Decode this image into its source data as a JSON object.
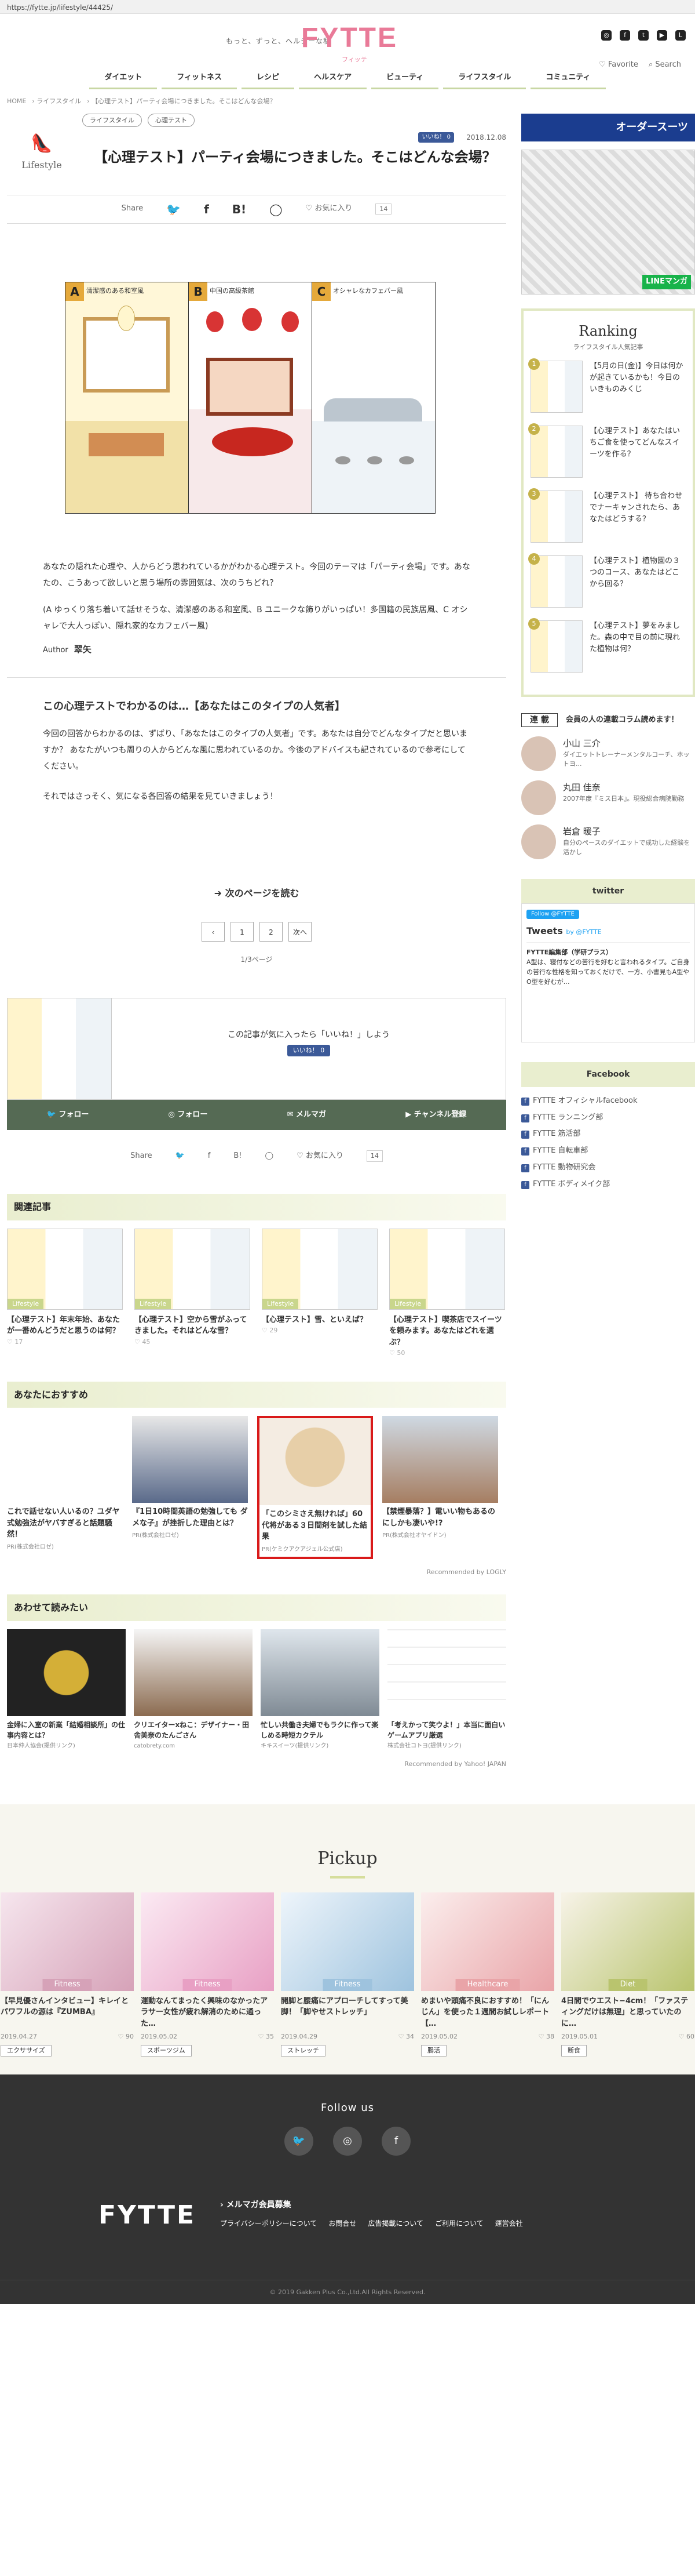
{
  "browser": {
    "url": "https://fytte.jp/lifestyle/44425/"
  },
  "header": {
    "tagline": "もっと、ずっと、ヘルシーな私",
    "logo": "FYTTE",
    "logo_sub": "フィッテ",
    "social": [
      "instagram-icon",
      "facebook-icon",
      "twitter-icon",
      "youtube-icon",
      "line-icon"
    ],
    "favorite": "Favorite",
    "search": "Search"
  },
  "nav": [
    "ダイエット",
    "フィットネス",
    "レシピ",
    "ヘルスケア",
    "ビューティ",
    "ライフスタイル",
    "コミュニティ"
  ],
  "breadcrumb": [
    "HOME",
    "ライフスタイル",
    "【心理テスト】パーティ会場につきました。そこはどんな会場？"
  ],
  "article": {
    "category": "Lifestyle",
    "tags": [
      "ライフスタイル",
      "心理テスト"
    ],
    "like_badge": "いいね！ 0",
    "date": "2018.12.08",
    "title": "【心理テスト】パーティ会場につきました。そこはどんな会場？",
    "share_label": "Share",
    "favorite_label": "お気に入り",
    "favorite_count": "14",
    "hero_panels": [
      {
        "letter": "A",
        "caption": "清潔感のある和室風"
      },
      {
        "letter": "B",
        "caption": "中国の高級茶館"
      },
      {
        "letter": "C",
        "caption": "オシャレなカフェバー風"
      }
    ],
    "intro1": "あなたの隠れた心理や、人からどう思われているかがわかる心理テスト。今回のテーマは「パーティ会場」です。あなたの、こうあって欲しいと思う場所の雰囲気は、次のうちどれ？",
    "intro2": "(A ゆっくり落ち着いて話せそうな、清潔感のある和室風、B ユニークな飾りがいっぱい！多国籍の民族居風、C オシャレで大人っぽい、隠れ家的なカフェバー風)",
    "author_label": "Author",
    "author_name": "翠矢",
    "section_title": "この心理テストでわかるのは…【あなたはこのタイプの人気者】",
    "body1": "今回の回答からわかるのは、ずばり、「あなたはこのタイプの人気者」です。あなたは自分でどんなタイプだと思いますか？ あなたがいつも周りの人からどんな風に思われているのか。今後のアドバイスも記されているので参考にしてください。",
    "body2": "それではさっそく、気になる各回答の結果を見ていきましょう！",
    "next_read": "次のページを読む",
    "pager": [
      "‹",
      "1",
      "2",
      "次へ"
    ],
    "page_info": "1/3ページ",
    "like_prompt": "この記事が気に入ったら「いいね！」しよう",
    "like_btn": "いいね！ 0",
    "follow_bar": [
      "フォロー",
      "フォロー",
      "メルマガ",
      "チャンネル登録"
    ]
  },
  "related": {
    "title": "関連記事",
    "items": [
      {
        "label": "Lifestyle",
        "title": "【心理テスト】年末年始、あなたが一番めんどうだと思うのは何？",
        "likes": "17"
      },
      {
        "label": "Lifestyle",
        "title": "【心理テスト】空から雪がふってきました。それはどんな雪？",
        "likes": "45"
      },
      {
        "label": "Lifestyle",
        "title": "【心理テスト】雪、といえば？",
        "likes": "29"
      },
      {
        "label": "Lifestyle",
        "title": "【心理テスト】喫茶店でスイーツを頼みます。あなたはどれを選ぶ？",
        "likes": "50"
      }
    ]
  },
  "recommend": {
    "title": "あなたにおすすめ",
    "items": [
      {
        "title": "これで話せない人いるの？ユダヤ式勉強法がヤバすぎると話題騒然！",
        "src": "PR(株式会社ロゼ)"
      },
      {
        "title": "『1日10時間英語の勉強しても ダメな子』が挫折した理由とは？",
        "src": "PR(株式会社ロゼ)"
      },
      {
        "title": "「このシミさえ無ければ」60代将がある３日間剤を試した結果",
        "src": "PR(ケミクアクアジェル公式店)"
      },
      {
        "title": "【禁煙暴落？】電いい物もあるのにしかも凄いや!?",
        "src": "PR(株式会社オヤイドン)"
      }
    ],
    "by": "Recommended by LOGLY"
  },
  "yaw": {
    "title": "あわせて読みたい",
    "items": [
      {
        "title": "金婦に入室の新業「結婚相談所」の仕事内容とは？",
        "src": "日本仲人協会(提供リンク)"
      },
      {
        "title": "クリエイターxねこ：デザイナー・田舎美奈のたんごさん",
        "src": "catobrety.com"
      },
      {
        "title": "忙しい共働き夫婦でもラクに作って楽しめる時短カクテル",
        "src": "キキスイーツ(提供リンク)"
      },
      {
        "title": "「考えかって笑ウよ！」本当に面白いゲームアプリ厳選",
        "src": "株式会社コトヨ(提供リンク)"
      }
    ],
    "by": "Recommended by Yahoo! JAPAN"
  },
  "sidebar": {
    "ad_banner": "オーダースーツ",
    "manga_ad": "LINEマンガ",
    "ranking_title": "Ranking",
    "ranking_sub": "ライフスタイル人気記事",
    "ranking": [
      {
        "num": "1",
        "title": "【5月の日(金)】今日は何かが起きているかも！今日のいきものみくじ"
      },
      {
        "num": "2",
        "title": "【心理テスト】あなたはいちご食を使ってどんなスイーツを作る？"
      },
      {
        "num": "3",
        "title": "【心理テスト】 待ち合わせでナーキャンされたら、あなたはどうする？"
      },
      {
        "num": "4",
        "title": "【心理テスト】植物園の３つのコース、あなたはどこから回る？"
      },
      {
        "num": "5",
        "title": "【心理テスト】夢をみました。森の中で目の前に現れた植物は何？"
      }
    ],
    "serial_badge": "連 載",
    "serial_text": "会員の人の連載コラム読めます！",
    "people": [
      {
        "name": "小山 三介",
        "desc": "ダイエットトレーナーメンタルコーチ、ホットヨ..."
      },
      {
        "name": "丸田 佳奈",
        "desc": "2007年度『ミス日本』。現役総合病院勤務"
      },
      {
        "name": "岩倉 暖子",
        "desc": "自分のペースのダイエットで成功した経験を活かし"
      }
    ],
    "twitter_title": "twitter",
    "tw_follow": "Follow @FYTTE",
    "tw_head": "Tweets",
    "tw_by": "by @FYTTE",
    "tw_account": "FYTTE編集部（学研プラス）",
    "tw_text": "A型は、寝付などの苦行を好むと言われるタイプ。ご自身の苦行な性格を知っておくだけで、一方、小書見もA型やO型を好むが…",
    "facebook_title": "Facebook",
    "fb_links": [
      "FYTTE オフィシャルfacebook",
      "FYTTE ランニング部",
      "FYTTE 筋活部",
      "FYTTE 自転車部",
      "FYTTE 動物研究会",
      "FYTTE ボディメイク部"
    ]
  },
  "pickup": {
    "title": "Pickup",
    "items": [
      {
        "label": "Fitness",
        "title": "【早見優さんインタビュー】キレイとパワフルの源は『ZUMBA』",
        "date": "2019.04.27",
        "likes": "90",
        "tag": "エクササイズ",
        "color": "#d6a2b8"
      },
      {
        "label": "Fitness",
        "title": "運動なんてまったく興味のなかったアラサー女性が疲れ解消のために通った…",
        "date": "2019.05.02",
        "likes": "35",
        "tag": "スポーツジム",
        "color": "#e8a0c4"
      },
      {
        "label": "Fitness",
        "title": "開脚と腰痛にアプローチしてすって美脚！「脚やせストレッチ」",
        "date": "2019.04.29",
        "likes": "34",
        "tag": "ストレッチ",
        "color": "#9ec3de"
      },
      {
        "label": "Healthcare",
        "title": "めまいや頭痛不良におすすめ！「にんじん」を使った１週間お試しレポート【…",
        "date": "2019.05.02",
        "likes": "38",
        "tag": "腸活",
        "color": "#e9a4a8"
      },
      {
        "label": "Diet",
        "title": "4日間でウエスト−4cm！「ファスティングだけは無理」と思っていたのに…",
        "date": "2019.05.01",
        "likes": "60",
        "tag": "断食",
        "color": "#b9c46e"
      }
    ]
  },
  "footer": {
    "follow_us": "Follow us",
    "logo": "FYTTE",
    "mail": "› メルマガ会員募集",
    "links": [
      "プライバシーポリシーについて",
      "お問合せ",
      "広告掲載について",
      "ご利用について",
      "運営会社"
    ],
    "copyright": "© 2019 Gakken Plus Co.,Ltd.All Rights Reserved."
  }
}
